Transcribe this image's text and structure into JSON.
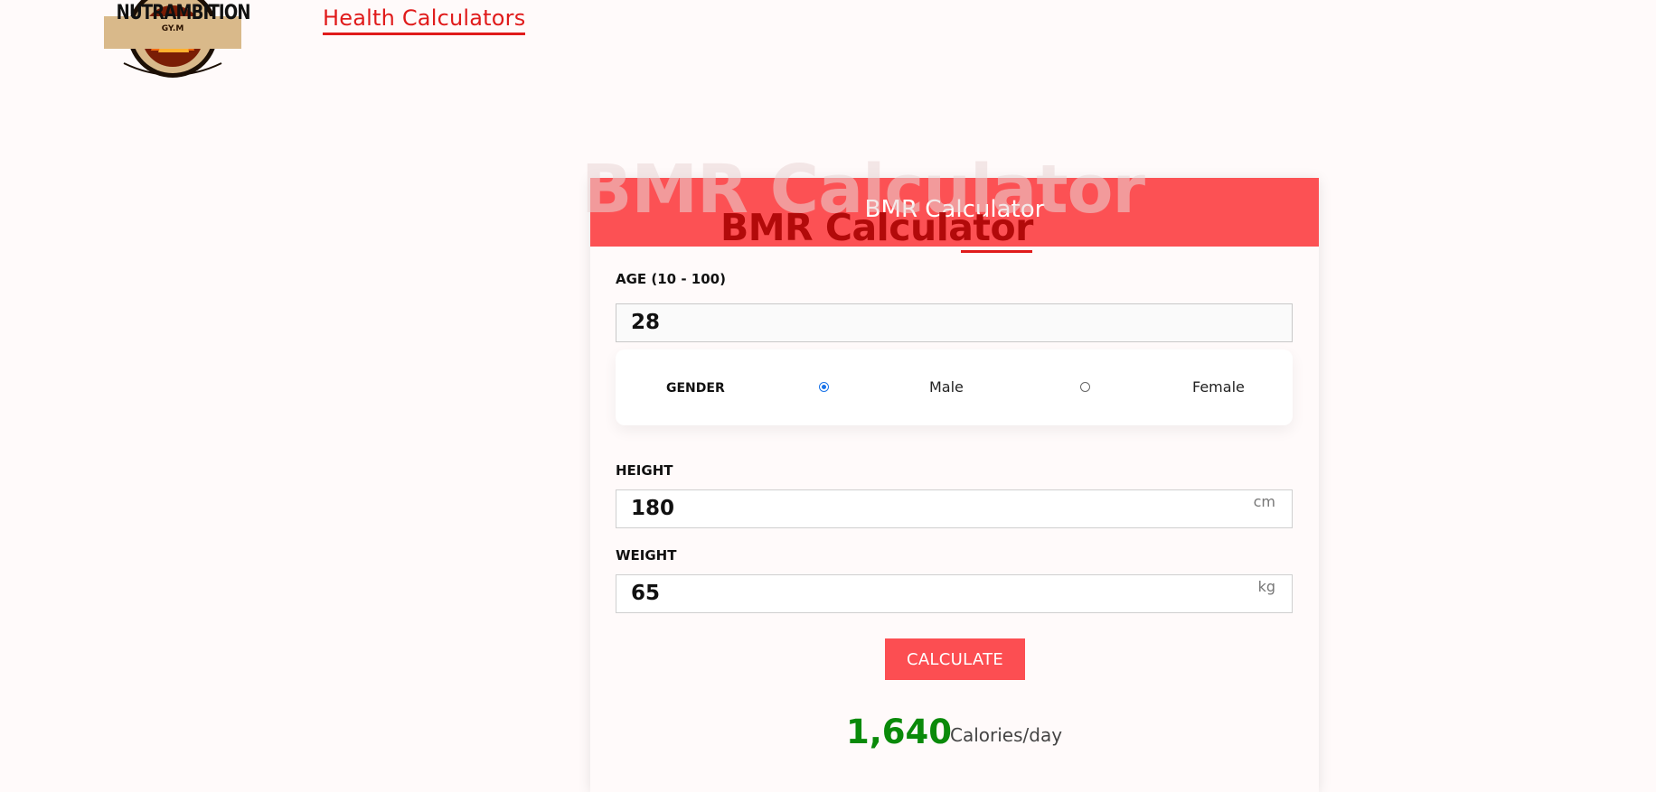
{
  "logo": {
    "text": "NUTRAMBITION",
    "sub_text": "GY.M"
  },
  "nav": {
    "link_label": "Health Calculators"
  },
  "watermark_title": "BMR Calculator",
  "card": {
    "header_title": "BMR Calculator",
    "overlap_title": "BMR Calculator",
    "age": {
      "label": "AGE (10 - 100)",
      "value": "28"
    },
    "gender": {
      "label": "GENDER",
      "options": [
        {
          "label": "Male",
          "checked": true
        },
        {
          "label": "Female",
          "checked": false
        }
      ]
    },
    "height": {
      "label": "HEIGHT",
      "value": "180",
      "unit": "cm"
    },
    "weight": {
      "label": "WEIGHT",
      "value": "65",
      "unit": "kg"
    },
    "calculate_label": "CALCULATE",
    "result": {
      "value": "1,640",
      "unit": "Calories/day"
    }
  },
  "colors": {
    "accent_red": "#fc5154",
    "link_red": "#e01b1b",
    "title_dark_red": "#b20a0a",
    "result_green": "#0a8a0a",
    "radio_blue": "#1a73e8"
  }
}
